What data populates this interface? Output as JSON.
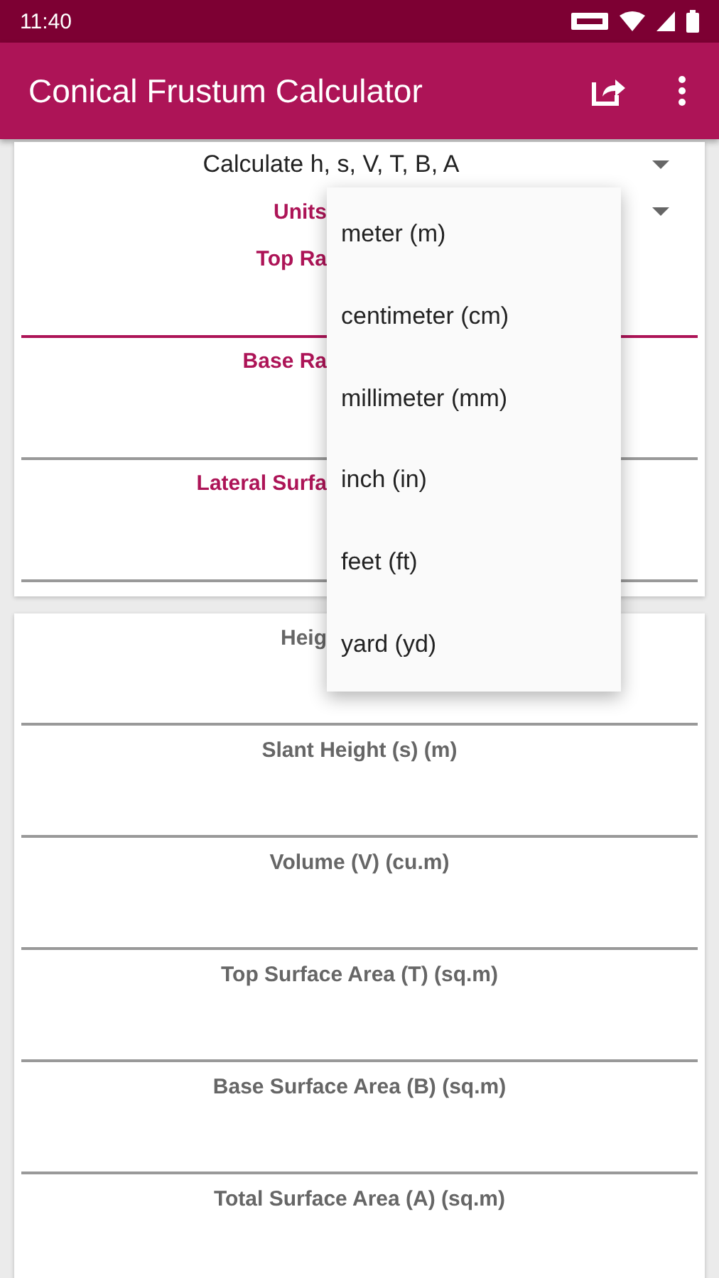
{
  "status_bar": {
    "time": "11:40"
  },
  "app_bar": {
    "title": "Conical Frustum Calculator"
  },
  "inputs_card": {
    "calculate_dropdown": {
      "value": "Calculate h, s, V, T, B, A"
    },
    "units_dropdown": {
      "label": "Units",
      "expanded": true
    },
    "fields": [
      {
        "label": "Top Ra",
        "focused": true,
        "partly_hidden": true
      },
      {
        "label": "Base Ra",
        "focused": false,
        "partly_hidden": true
      },
      {
        "label": "Lateral Surfa",
        "focused": false,
        "partly_hidden": true
      }
    ]
  },
  "results_card": {
    "fields": [
      {
        "label": "Heig",
        "partly_hidden": true
      },
      {
        "label": "Slant Height (s) (m)",
        "partly_hidden": false
      },
      {
        "label": "Volume (V) (cu.m)",
        "partly_hidden": false
      },
      {
        "label": "Top Surface Area (T) (sq.m)",
        "partly_hidden": false
      },
      {
        "label": "Base Surface Area (B) (sq.m)",
        "partly_hidden": false
      },
      {
        "label": "Total Surface Area (A) (sq.m)",
        "partly_hidden": false
      }
    ]
  },
  "units_menu": {
    "items": [
      {
        "label": "meter (m)"
      },
      {
        "label": "centimeter (cm)"
      },
      {
        "label": "millimeter (mm)"
      },
      {
        "label": "inch (in)"
      },
      {
        "label": "feet (ft)"
      },
      {
        "label": "yard (yd)"
      }
    ]
  }
}
